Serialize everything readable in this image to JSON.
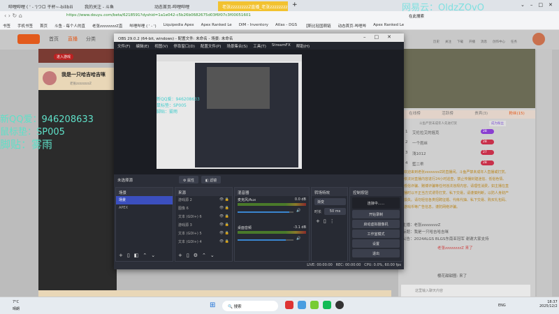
{
  "browser": {
    "tabs": [
      "哔哩哔哩 ( ' - ')つロ 干杯~-bilibili",
      "我的关注 - 斗鱼",
      "动态首页-哔哩哔哩",
      "老张zzzzzzzzZ直播_老张zzzzzzzz"
    ],
    "new_tab": "+",
    "url": "https://www.douyu.com/beta/6218591?dyshid=1a1e042-c5b26b0682675d03f6f07c3f00051601",
    "search_label": "在此搜索",
    "watermark": "网易云：OldzZOvO",
    "bookmarks": [
      "书签",
      "手机书签",
      "首页",
      "斗鱼 - 每个人的直",
      "老张zzzzzzzzZ直",
      "哔哩哔哩 ( ' - ')",
      "Liquipedia Apex",
      "Apex Ranked Le",
      "DIM - Inventory",
      "Atlas - DGS",
      "【斯比轻国萌链",
      "动态首页-哔哩哔",
      "Apex Ranked Le"
    ]
  },
  "site": {
    "nav": [
      "首页",
      "直播",
      "分类"
    ],
    "header_icons": [
      "历史",
      "关注",
      "下载",
      "开播",
      "消息",
      "创作中心",
      "任务"
    ],
    "room_title": "我是一只哈吉哈吉咪",
    "streamer": "老张zzzzzzzzZ",
    "banner_btn": "进入游戏"
  },
  "overlay": {
    "lines": [
      "新QQ爱：946208633",
      "鼠标垫：SP005",
      "脚贴：雾雨"
    ]
  },
  "obs": {
    "title": "OBS 29.0.2 (64-bit, windows) - 配置文件: 未命名 - 场景: 未命名",
    "menu": [
      "文件(F)",
      "编辑(E)",
      "视图(V)",
      "停靠窗口(D)",
      "配置文件(P)",
      "场景集合(S)",
      "工具(T)",
      "StreamFX",
      "帮助(H)"
    ],
    "no_source": "未选择源",
    "properties": "属性",
    "filters": "滤镜",
    "scenes": {
      "title": "场景",
      "items": [
        "场景",
        "APEX"
      ]
    },
    "sources": {
      "title": "来源",
      "items": [
        "游戏源 2",
        "图像 6",
        "文本 (GDI+) 6",
        "游戏源 3",
        "文本 (GDI+) 5",
        "文本 (GDI+) 4"
      ]
    },
    "mixer": {
      "title": "混音器",
      "channels": [
        {
          "name": "麦克风/Aux",
          "db": "0.0 dB",
          "volume": 0.92
        },
        {
          "name": "桌面音频",
          "db": "-3.1 dB",
          "volume": 0.86
        }
      ]
    },
    "transitions": {
      "title": "转场特效",
      "type": "渐变",
      "duration_label": "时长",
      "duration": "50 ms"
    },
    "controls": {
      "title": "控制按钮",
      "buttons": [
        "连接中......",
        "开始录制",
        "启动虚拟摄像机",
        "工作室模式",
        "设置",
        "退出"
      ]
    },
    "status": {
      "live": "LIVE: 00:00:00",
      "rec": "REC: 00:00:00",
      "cpu": "CPU: 0.0%, 60.00 fps"
    }
  },
  "chat": {
    "tabs": [
      "在线榜",
      "活跃榜",
      "贵宾(3)",
      "粉丝(15)"
    ],
    "fan_button": "成为粉丝",
    "notice_small": "斗鱼严禁未成年人先进打赏",
    "ranks": [
      {
        "n": "1",
        "name": "艾伦拉艾的摇克",
        "lvl": "28"
      },
      {
        "n": "2",
        "name": "一个雨丝",
        "lvl": "28"
      },
      {
        "n": "3",
        "name": "浅1012",
        "lvl": "27"
      },
      {
        "n": "4",
        "name": "藍二乖",
        "lvl": "28"
      }
    ],
    "welcome": "欢迎来到老张zzzzzzzzZ的直播间。斗鱼严禁未成年人直播或打赏。依法对直播内容进行24小时巡查，禁止传播封建迷信、低俗色情、低俗诈骗、赌博诈骗等任何违法违规内容。请理性消费，如主播在直播时以不正当方式诱导打赏、私下交易，请谨慎判断，以防人身财产损失。请勿轻信各类招聘征婚、代练代抽、私下交易、购买礼包码、游戏币等广告信息，谨防网络诈骗。",
    "host": "主播：老张zzzzzzzzZ",
    "room": "标题：我是一只哈吉哈吉咪",
    "announce": "公告：2024ALGS BLGS东南亚冠军 谢谢大家支持",
    "msg1": "老张zzzzzzzzZ 来了",
    "msg2": "樱花甜甜圈: 来了",
    "input_placeholder": "这里输入聊天内容"
  },
  "taskbar": {
    "weather": "7°C",
    "weather_desc": "晴朗",
    "search": "搜索",
    "lang": "ENG",
    "time": "18:37",
    "date": "2025/12/2"
  }
}
